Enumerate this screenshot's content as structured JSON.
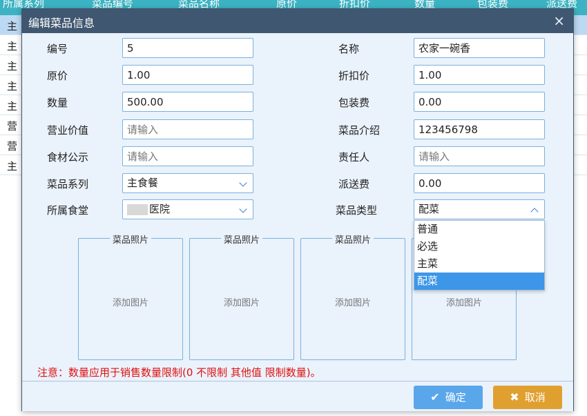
{
  "background_table": {
    "headers": [
      "所属系列",
      "菜品编号",
      "菜品名称",
      "原价",
      "折扣价",
      "数量",
      "包装费",
      "派送费"
    ],
    "rows": [
      "主",
      "主",
      "主",
      "主",
      "主",
      "营",
      "营",
      "主"
    ]
  },
  "dialog": {
    "title": "编辑菜品信息",
    "close": "×"
  },
  "form": {
    "code_label": "编号",
    "code_value": "5",
    "name_label": "名称",
    "name_value": "农家一碗香",
    "price_label": "原价",
    "price_value": "1.00",
    "discount_label": "折扣价",
    "discount_value": "1.00",
    "qty_label": "数量",
    "qty_value": "500.00",
    "pack_label": "包装费",
    "pack_value": "0.00",
    "biz_label": "营业价值",
    "biz_placeholder": "请输入",
    "intro_label": "菜品介绍",
    "intro_value": "123456798",
    "ingredient_label": "食材公示",
    "ingredient_placeholder": "请输入",
    "owner_label": "责任人",
    "owner_placeholder": "请输入",
    "series_label": "菜品系列",
    "series_value": "主食餐",
    "delivery_label": "派送费",
    "delivery_value": "0.00",
    "canteen_label": "所属食堂",
    "canteen_value": "医院",
    "type_label": "菜品类型",
    "type_value": "配菜"
  },
  "type_options": [
    "普通",
    "必选",
    "主菜",
    "配菜"
  ],
  "photos": {
    "caption": "菜品照片",
    "add": "添加图片"
  },
  "note": "注意：数量应用于销售数量限制(0 不限制 其他值 限制数量)。",
  "buttons": {
    "ok": "确定",
    "ok_icon": "✔",
    "cancel": "取消",
    "cancel_icon": "✖"
  }
}
